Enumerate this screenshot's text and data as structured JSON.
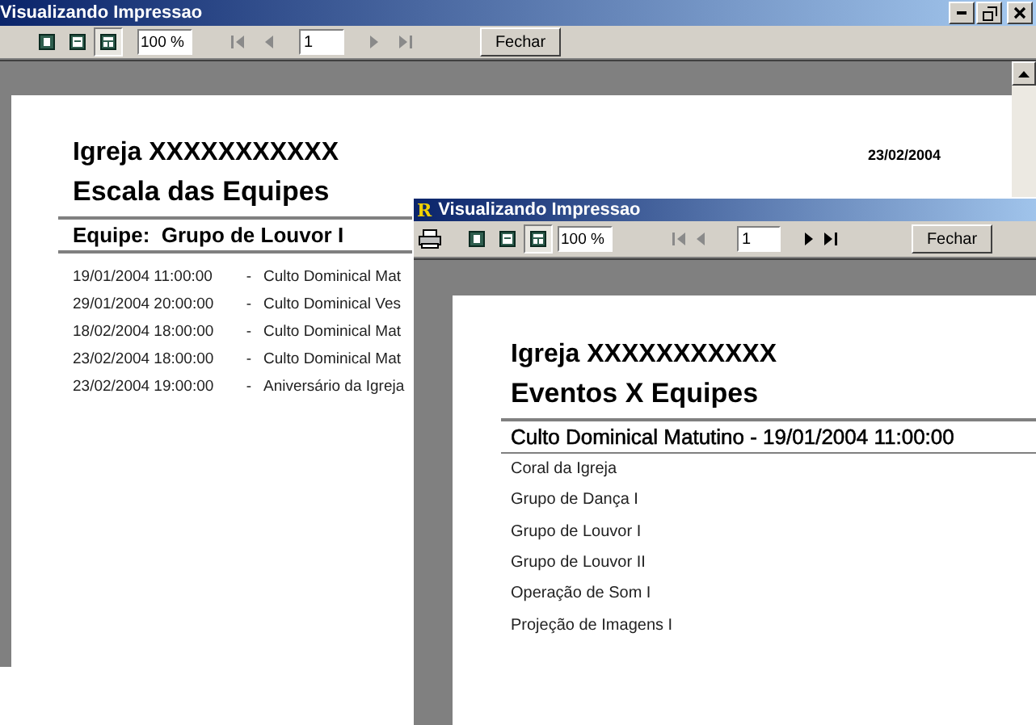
{
  "windows": [
    {
      "title": "Visualizando Impressao",
      "print_button": false,
      "window_controls": true,
      "toolbar": {
        "view_buttons": [
          {
            "kind": "one-page",
            "selected": false
          },
          {
            "kind": "page-width",
            "selected": false
          },
          {
            "kind": "multi-page",
            "selected": true
          }
        ],
        "zoom": "100 %",
        "page": "1",
        "nav": [
          {
            "kind": "first",
            "disabled": true
          },
          {
            "kind": "prev",
            "disabled": true
          },
          {
            "kind": "next",
            "disabled": true
          },
          {
            "kind": "last",
            "disabled": true
          }
        ],
        "close_button": "Fechar"
      },
      "report": {
        "company": "Igreja XXXXXXXXXXX",
        "title": "Escala das Equipes",
        "date": "23/02/2004",
        "group_header": "Equipe:  Grupo de Louvor I",
        "rows": [
          {
            "datetime": "19/01/2004 11:00:00",
            "separator": "-",
            "event": "Culto Dominical Mat"
          },
          {
            "datetime": "29/01/2004 20:00:00",
            "separator": "-",
            "event": "Culto Dominical Ves"
          },
          {
            "datetime": "18/02/2004 18:00:00",
            "separator": "-",
            "event": "Culto Dominical Mat"
          },
          {
            "datetime": "23/02/2004 18:00:00",
            "separator": "-",
            "event": "Culto Dominical Mat"
          },
          {
            "datetime": "23/02/2004 19:00:00",
            "separator": "-",
            "event": "Aniversário da Igreja"
          }
        ]
      }
    },
    {
      "title": "Visualizando Impressao",
      "app_icon": "R",
      "print_button": true,
      "window_controls": false,
      "toolbar": {
        "view_buttons": [
          {
            "kind": "one-page",
            "selected": false
          },
          {
            "kind": "page-width",
            "selected": false
          },
          {
            "kind": "multi-page",
            "selected": true
          }
        ],
        "zoom": "100 %",
        "page": "1",
        "nav": [
          {
            "kind": "first",
            "disabled": true
          },
          {
            "kind": "prev",
            "disabled": true
          },
          {
            "kind": "next",
            "disabled": false
          },
          {
            "kind": "last",
            "disabled": false
          }
        ],
        "close_button": "Fechar"
      },
      "report": {
        "company": "Igreja XXXXXXXXXXX",
        "title": "Eventos X Equipes",
        "group_header": "Culto Dominical Matutino - 19/01/2004 11:00:00",
        "rows": [
          {
            "team": "Coral da Igreja"
          },
          {
            "team": "Grupo de Dança I"
          },
          {
            "team": "Grupo de Louvor I"
          },
          {
            "team": "Grupo de Louvor II"
          },
          {
            "team": "Operação de Som I"
          },
          {
            "team": "Projeção de Imagens I"
          }
        ]
      }
    }
  ]
}
